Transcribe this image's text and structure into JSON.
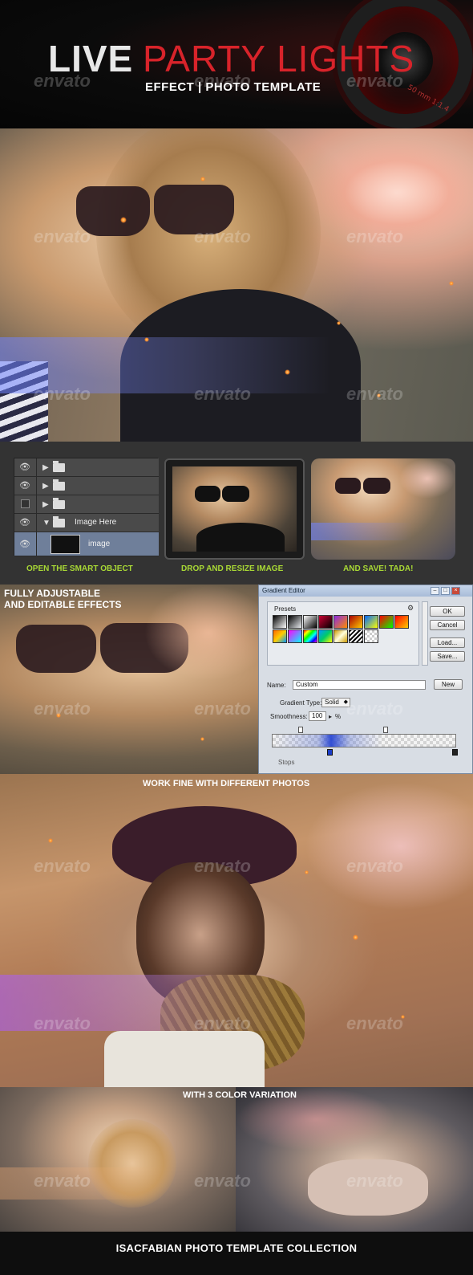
{
  "header": {
    "title_live": "LIVE",
    "title_party": "PARTY LIGHTS",
    "subtitle": "EFFECT | PHOTO TEMPLATE",
    "lens_text": "50 mm 1:1.4",
    "watermark": "envato"
  },
  "layers_panel": {
    "rows": [
      {
        "name": ""
      },
      {
        "name": ""
      },
      {
        "name": ""
      },
      {
        "name": "Image Here"
      },
      {
        "name": "image"
      }
    ]
  },
  "steps": {
    "step1": "OPEN THE SMART OBJECT",
    "step2": "DROP AND RESIZE IMAGE",
    "step3": "AND SAVE! TADA!"
  },
  "adjustable": {
    "line1": "FULLY ADJUSTABLE",
    "line2": "AND EDITABLE EFFECTS"
  },
  "gradient_editor": {
    "title": "Gradient Editor",
    "presets_label": "Presets",
    "ok": "OK",
    "cancel": "Cancel",
    "load": "Load...",
    "save": "Save...",
    "name_label": "Name:",
    "name_value": "Custom",
    "new": "New",
    "type_label": "Gradient Type:",
    "type_value": "Solid",
    "smooth_label": "Smoothness:",
    "smooth_value": "100",
    "percent": "%",
    "stops_label": "Stops"
  },
  "work": {
    "caption": "WORK FINE WITH DIFFERENT PHOTOS"
  },
  "variation": {
    "caption": "WITH 3 COLOR VARIATION"
  },
  "footer": {
    "text": "ISACFABIAN PHOTO TEMPLATE COLLECTION"
  },
  "colors": {
    "accent_red": "#d8232a",
    "accent_green": "#a8d835"
  }
}
